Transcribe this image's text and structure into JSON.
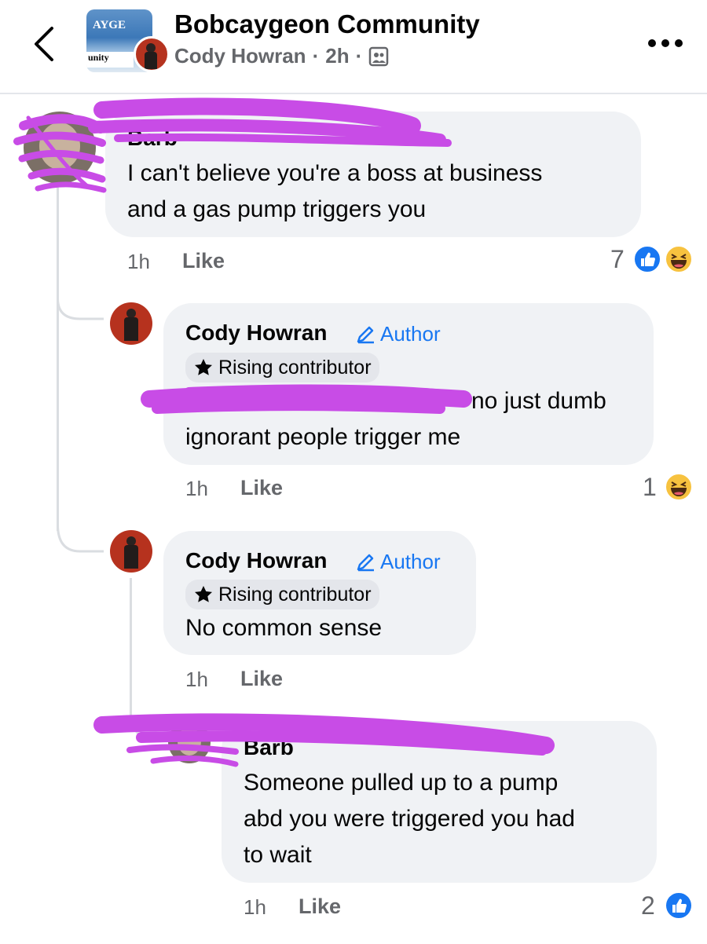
{
  "header": {
    "title": "Bobcaygeon Community",
    "author": "Cody Howran",
    "time": "2h",
    "dot1": "·",
    "dot2": "·",
    "group_logo_text_top": "AYGE",
    "group_logo_text_bottom": "unity"
  },
  "comments": [
    {
      "name_fragment": "Barb",
      "text_line1": "I can't believe you're a boss at business",
      "text_line2": "and a gas pump triggers you",
      "time": "1h",
      "like": "Like",
      "reaction_count": "7",
      "reactions": [
        "like-icon",
        "haha-icon"
      ]
    },
    {
      "name": "Cody Howran",
      "author_label": "Author",
      "badge": "Rising contributor",
      "text_line1": "no just dumb",
      "text_line2": "ignorant people trigger me",
      "time": "1h",
      "like": "Like",
      "reaction_count": "1",
      "reactions": [
        "haha-icon"
      ]
    },
    {
      "name": "Cody Howran",
      "author_label": "Author",
      "badge": "Rising contributor",
      "text_line1": "No common sense",
      "time": "1h",
      "like": "Like"
    },
    {
      "name_fragment": "Barb",
      "text_line1": "Someone pulled up to a pump",
      "text_line2": "abd you were triggered you had",
      "text_line3": "to wait",
      "time": "1h",
      "like": "Like",
      "reaction_count": "2",
      "reactions": [
        "like-icon"
      ]
    }
  ],
  "colors": {
    "accent": "#1877f2",
    "bubble": "#f0f2f5",
    "muted": "#65676b",
    "redaction": "#c84ce6"
  }
}
